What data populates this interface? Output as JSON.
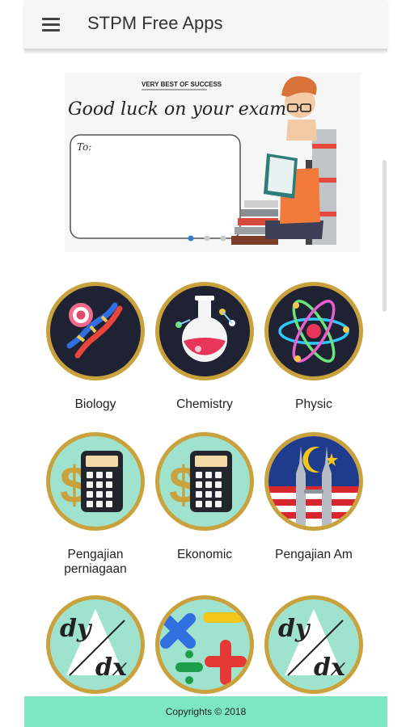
{
  "app_bar": {
    "title": "STPM Free Apps",
    "menu_icon": "hamburger-menu-icon"
  },
  "banner": {
    "tagline": "VERY BEST OF SUCCESS",
    "headline": "Good luck on your exam",
    "to_label": "To:",
    "slide_count": 3,
    "active_slide": 0
  },
  "subjects": [
    {
      "label": "Biology",
      "icon": "dna-icon"
    },
    {
      "label": "Chemistry",
      "icon": "flask-icon"
    },
    {
      "label": "Physic",
      "icon": "atom-icon"
    },
    {
      "label": "Pengajian perniagaan",
      "icon": "calculator-icon"
    },
    {
      "label": "Ekonomic",
      "icon": "calculator-icon"
    },
    {
      "label": "Pengajian Am",
      "icon": "twin-towers-icon"
    },
    {
      "label": "",
      "icon": "dy-dx-icon"
    },
    {
      "label": "",
      "icon": "math-symbols-icon"
    },
    {
      "label": "",
      "icon": "dy-dx-icon"
    }
  ],
  "colors": {
    "footer_bg": "#7de7c4",
    "tile_ring": "#c9a23e",
    "tile_dark_bg": "#1e2233",
    "tile_mint_bg": "#9fe3cf"
  },
  "footer": {
    "text": "Copyrights © 2018"
  }
}
